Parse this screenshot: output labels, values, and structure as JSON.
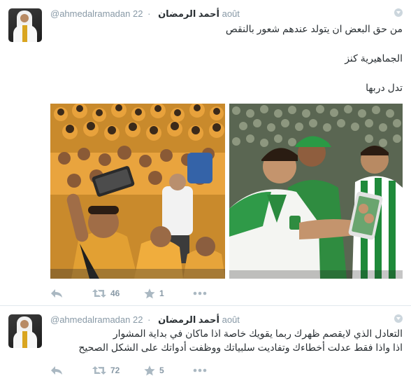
{
  "tweets": [
    {
      "handle": "@ahmedalramadan",
      "display_name": "أحمد الرمضان",
      "separator": "·",
      "time": "22 août",
      "lines": [
        "من حق البعض ان يتولد عندهم شعور بالنقص",
        "الجماهيرية كنز",
        "تدل دربها"
      ],
      "retweets": "46",
      "favorites": "1",
      "photos": [
        {
          "alt": "team-selfie-orange-kits",
          "colors": {
            "crowd": "#d9952a",
            "kit": "#e8a03b",
            "dark": "#2a2a2a"
          }
        },
        {
          "alt": "players-green-white-kits",
          "colors": {
            "crowd": "#6b7a5e",
            "kit": "#2e8b3f",
            "white": "#f3f5f2"
          }
        }
      ]
    },
    {
      "handle": "@ahmedalramadan",
      "display_name": "أحمد الرمضان",
      "separator": "·",
      "time": "22 août",
      "lines": [
        "التعادل الذي لايقصم ظهرك ربما يقويك خاصة اذا ماكان في بداية المشوار",
        "اذا واذا فقط عدلت أخطاءك وتفاديت سلبياتك ووظفت أدواتك على الشكل الصحيح"
      ],
      "retweets": "72",
      "favorites": "5"
    }
  ],
  "icons": {
    "reply": "reply-icon",
    "retweet": "retweet-icon",
    "favorite": "star-icon",
    "more": "more-icon",
    "caret": "caret-icon"
  },
  "colors": {
    "text": "#292f33",
    "muted": "#8899a6",
    "icon": "#aab8c2",
    "border": "#e1e8ed"
  }
}
